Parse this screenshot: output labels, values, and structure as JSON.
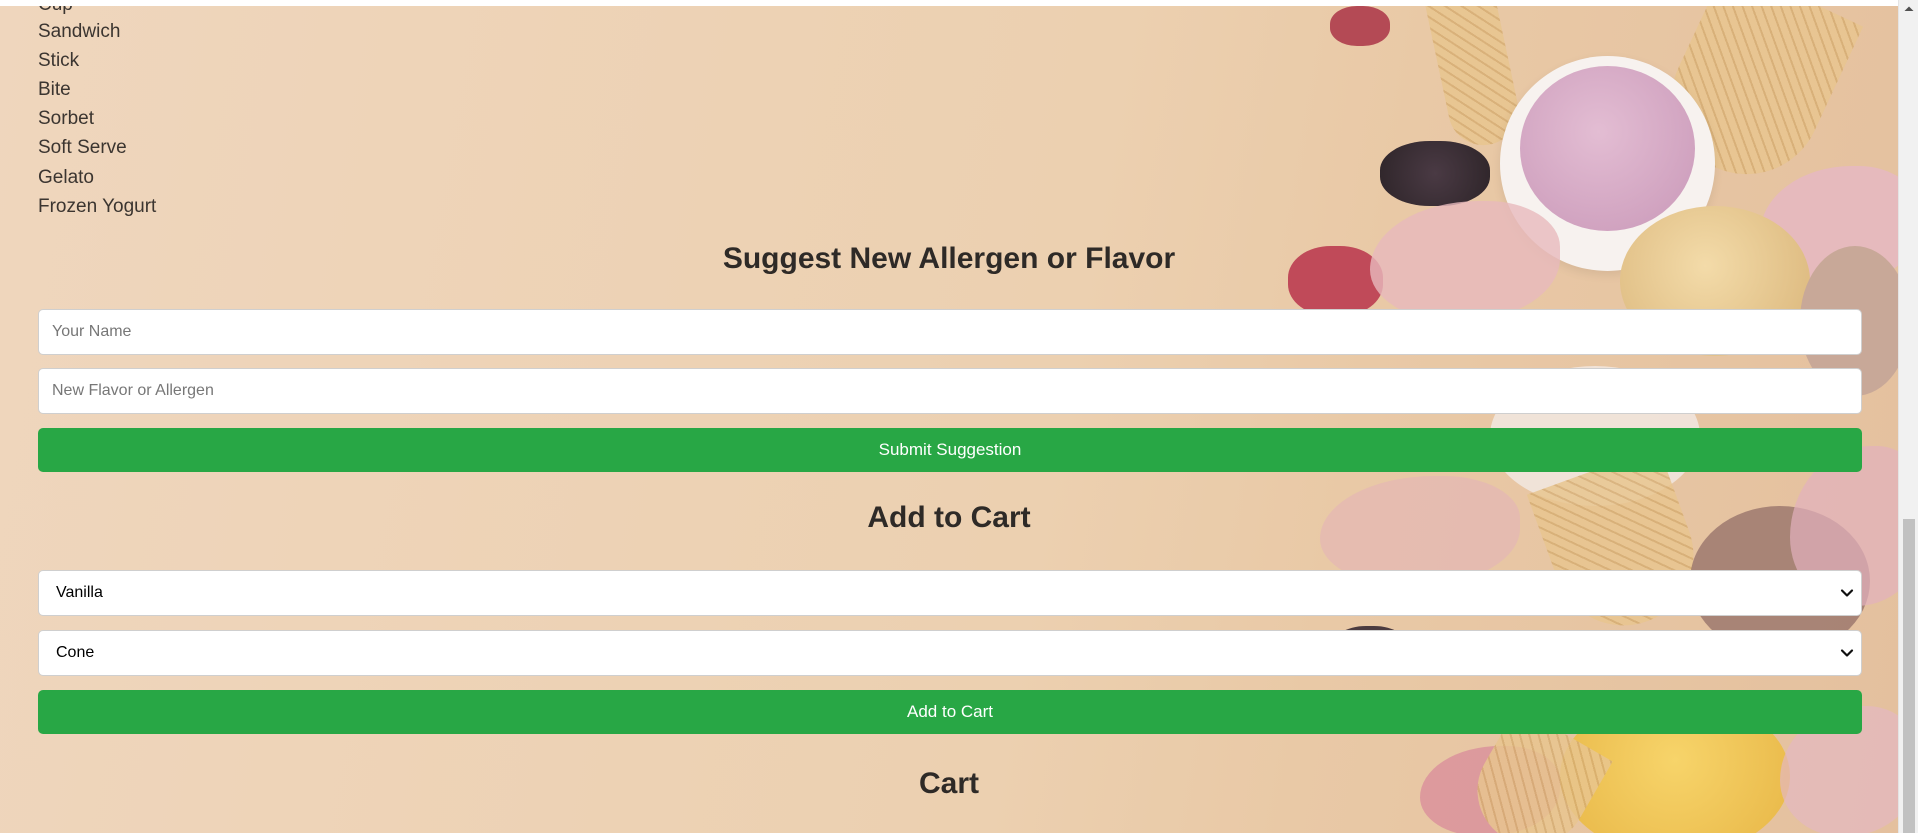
{
  "types_list": {
    "items": [
      "Cup",
      "Sandwich",
      "Stick",
      "Bite",
      "Sorbet",
      "Soft Serve",
      "Gelato",
      "Frozen Yogurt"
    ]
  },
  "suggest": {
    "title": "Suggest New Allergen or Flavor",
    "name_placeholder": "Your Name",
    "flavor_placeholder": "New Flavor or Allergen",
    "submit_label": "Submit Suggestion"
  },
  "add_to_cart": {
    "title": "Add to Cart",
    "flavor_selected": "Vanilla",
    "type_selected": "Cone",
    "button_label": "Add to Cart"
  },
  "cart": {
    "title": "Cart"
  },
  "colors": {
    "accent_green": "#28a745",
    "background": "#efd6bd"
  },
  "icons": {
    "select_arrow": "chevron-down-icon",
    "scroll_up": "scroll-up-arrow-icon"
  }
}
